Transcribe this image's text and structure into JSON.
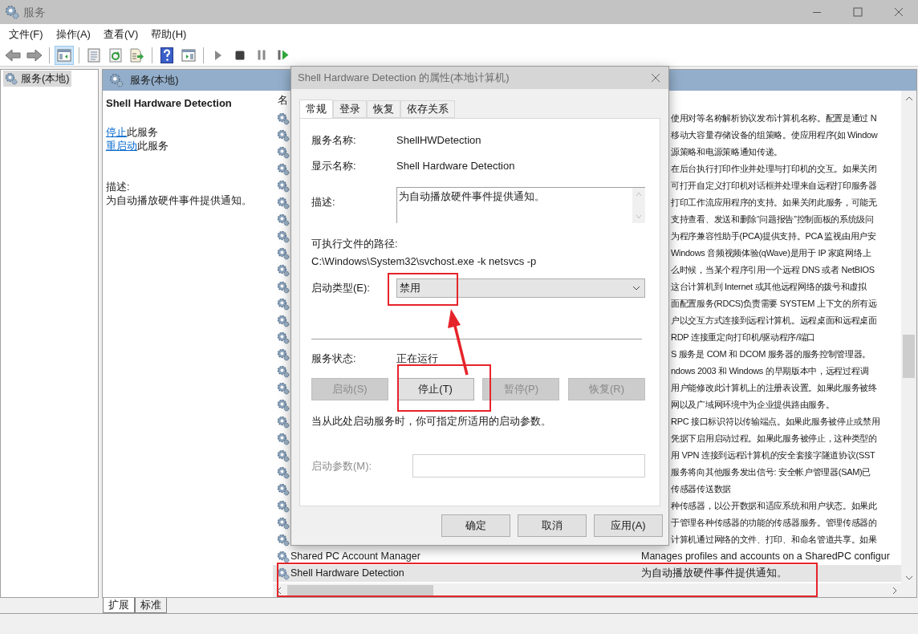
{
  "window": {
    "title": "服务"
  },
  "menu": [
    "文件(F)",
    "操作(A)",
    "查看(V)",
    "帮助(H)"
  ],
  "toolbar": [
    {
      "kind": "back",
      "pressed": false
    },
    {
      "kind": "forward",
      "pressed": false
    },
    {
      "kind": "sep"
    },
    {
      "kind": "tree",
      "pressed": true
    },
    {
      "kind": "sep"
    },
    {
      "kind": "properties",
      "pressed": false
    },
    {
      "kind": "refresh",
      "pressed": false
    },
    {
      "kind": "export",
      "pressed": false
    },
    {
      "kind": "sep"
    },
    {
      "kind": "help",
      "pressed": false
    },
    {
      "kind": "pane",
      "pressed": false
    },
    {
      "kind": "sep"
    },
    {
      "kind": "play",
      "pressed": false
    },
    {
      "kind": "stop",
      "pressed": false
    },
    {
      "kind": "pause",
      "pressed": false
    },
    {
      "kind": "resume",
      "pressed": false
    }
  ],
  "tree": [
    {
      "label": "服务(本地)",
      "selected": true
    }
  ],
  "panel": {
    "title": "服务(本地)",
    "service_name": "Shell Hardware Detection",
    "actions": [
      {
        "link": "停止",
        "text": "此服务"
      },
      {
        "link": "重启动",
        "text": "此服务"
      }
    ],
    "description_label": "描述:",
    "description": "为自动播放硬件事件提供通知。"
  },
  "list": {
    "column_1": "名",
    "rows": [
      {
        "kind": "covered",
        "selected": false,
        "description": "使用对等名称解析协议发布计算机名称。配置是通过 N"
      },
      {
        "kind": "covered",
        "selected": false,
        "description": "移动大容量存储设备的组策略。使应用程序(如 Window"
      },
      {
        "kind": "covered",
        "selected": false,
        "description": "源策略和电源策略通知传递。"
      },
      {
        "kind": "covered",
        "selected": false,
        "description": "在后台执行打印作业并处理与打印机的交互。如果关闭"
      },
      {
        "kind": "covered",
        "selected": false,
        "description": "可打开自定义打印机对话框并处理来自远程打印服务器"
      },
      {
        "kind": "covered",
        "selected": false,
        "description": "打印工作流应用程序的支持。如果关闭此服务，可能无"
      },
      {
        "kind": "covered",
        "selected": false,
        "description": "支持查看、发送和删除“问题报告”控制面板的系统级问"
      },
      {
        "kind": "covered",
        "selected": false,
        "description": "为程序兼容性助手(PCA)提供支持。PCA 监视由用户安"
      },
      {
        "kind": "covered",
        "selected": false,
        "description": "Windows 音频视频体验(qWave)是用于 IP 家庭网络上"
      },
      {
        "kind": "covered",
        "selected": false,
        "description": "么时候，当某个程序引用一个远程 DNS 或者 NetBIOS"
      },
      {
        "kind": "covered",
        "selected": false,
        "description": "这台计算机到 Internet 或其他远程网络的拨号和虚拟"
      },
      {
        "kind": "covered",
        "selected": false,
        "description": "面配置服务(RDCS)负责需要 SYSTEM 上下文的所有远"
      },
      {
        "kind": "covered",
        "selected": false,
        "description": "户以交互方式连接到远程计算机。远程桌面和远程桌面"
      },
      {
        "kind": "covered",
        "selected": false,
        "description": "RDP 连接重定向打印机/驱动程序/端口"
      },
      {
        "kind": "covered",
        "selected": false,
        "description": "S 服务是 COM 和 DCOM 服务器的服务控制管理器。"
      },
      {
        "kind": "covered",
        "selected": false,
        "description": "ndows 2003 和 Windows 的早期版本中，远程过程调"
      },
      {
        "kind": "covered",
        "selected": false,
        "description": "用户能修改此计算机上的注册表设置。如果此服务被终"
      },
      {
        "kind": "covered",
        "selected": false,
        "description": "网以及广域网环境中为企业提供路由服务。"
      },
      {
        "kind": "covered",
        "selected": false,
        "description": "RPC 接口标识符以传输端点。如果此服务被停止或禁用"
      },
      {
        "kind": "covered",
        "selected": false,
        "description": "凭据下启用启动过程。如果此服务被停止，这种类型的"
      },
      {
        "kind": "covered",
        "selected": false,
        "description": "用 VPN 连接到远程计算机的安全套接字隧道协议(SST"
      },
      {
        "kind": "covered",
        "selected": false,
        "description": "服务将向其他服务发出信号: 安全帐户管理器(SAM)已"
      },
      {
        "kind": "covered",
        "selected": false,
        "description": "传感器传送数据"
      },
      {
        "kind": "covered",
        "selected": false,
        "description": "种传感器，以公开数据和适应系统和用户状态。如果此"
      },
      {
        "kind": "covered",
        "selected": false,
        "description": "于管理各种传感器的功能的传感器服务。管理传感器的"
      },
      {
        "kind": "covered",
        "selected": false,
        "description": "计算机通过网络的文件、打印、和命名管道共享。如果"
      },
      {
        "kind": "full",
        "selected": false,
        "name": "Shared PC Account Manager",
        "description": "Manages profiles and accounts on a SharedPC configur"
      },
      {
        "kind": "full",
        "selected": true,
        "name": "Shell Hardware Detection",
        "description": "为自动播放硬件事件提供通知。"
      }
    ]
  },
  "bottom_tabs": [
    {
      "label": "扩展",
      "selected": true
    },
    {
      "label": "标准",
      "selected": false
    }
  ],
  "dialog": {
    "title": "Shell Hardware Detection 的属性(本地计算机)",
    "tabs": [
      {
        "label": "常规",
        "selected": true
      },
      {
        "label": "登录",
        "selected": false
      },
      {
        "label": "恢复",
        "selected": false
      },
      {
        "label": "依存关系",
        "selected": false
      }
    ],
    "service_name_label": "服务名称:",
    "service_name": "ShellHWDetection",
    "display_name_label": "显示名称:",
    "display_name": "Shell Hardware Detection",
    "description_label": "描述:",
    "description": "为自动播放硬件事件提供通知。",
    "path_label": "可执行文件的路径:",
    "path": "C:\\Windows\\System32\\svchost.exe -k netsvcs -p",
    "startup_type_label": "启动类型(E):",
    "startup_type": "禁用",
    "status_label": "服务状态:",
    "status": "正在运行",
    "control_buttons": [
      {
        "label": "启动(S)",
        "disabled": true
      },
      {
        "label": "停止(T)",
        "disabled": false
      },
      {
        "label": "暂停(P)",
        "disabled": true
      },
      {
        "label": "恢复(R)",
        "disabled": true
      }
    ],
    "hint": "当从此处启动服务时，你可指定所适用的启动参数。",
    "params": {
      "label": "启动参数(M):",
      "disabled": true
    },
    "footer_buttons": [
      {
        "label": "确定"
      },
      {
        "label": "取消"
      },
      {
        "label": "应用(A)"
      }
    ]
  }
}
